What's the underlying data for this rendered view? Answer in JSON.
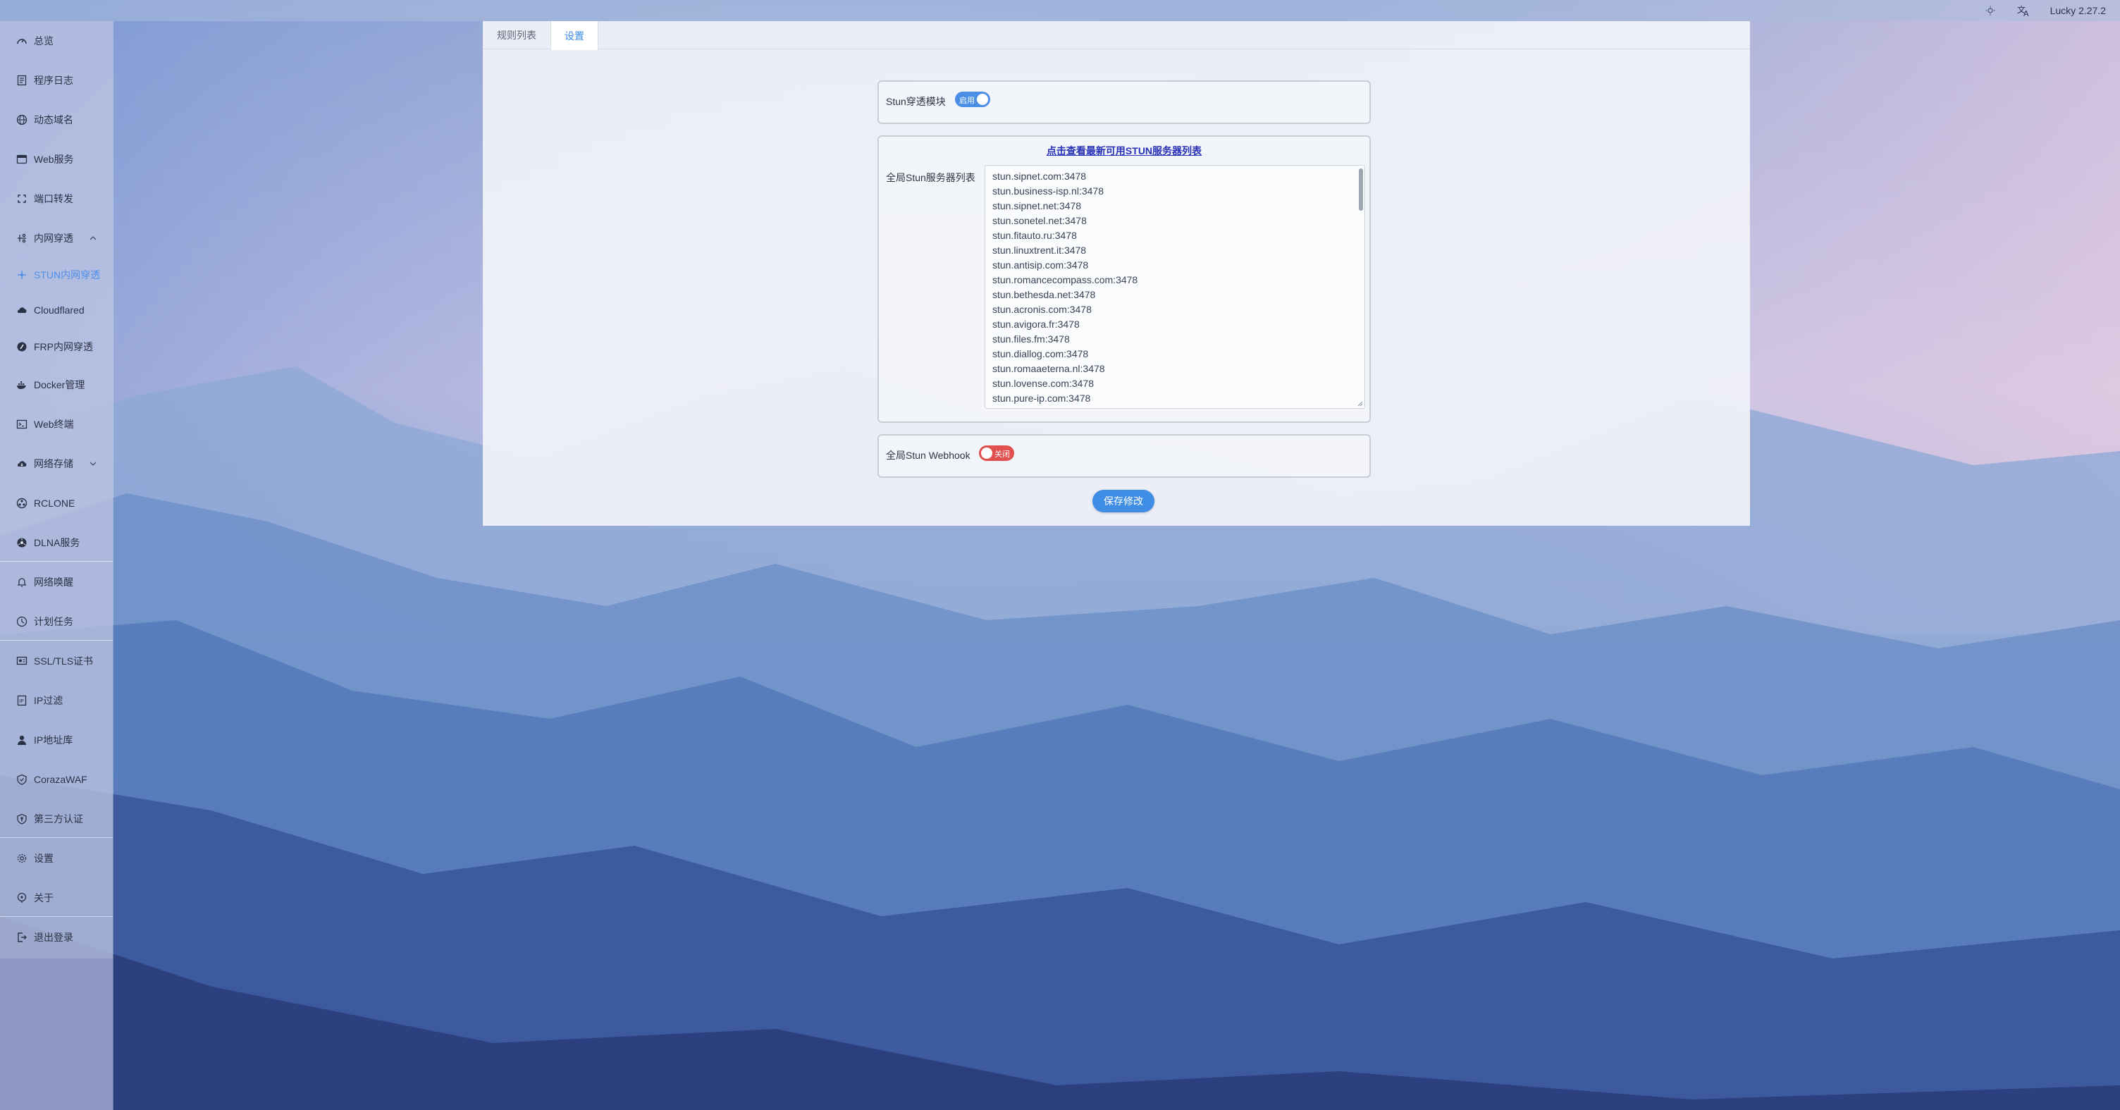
{
  "topbar": {
    "version_label": "Lucky 2.27.2",
    "theme_icon": "sun-icon",
    "language_icon": "translate-icon"
  },
  "sidebar": {
    "items": [
      {
        "label": "总览",
        "icon": "dashboard-icon"
      },
      {
        "label": "程序日志",
        "icon": "log-icon"
      },
      {
        "label": "动态域名",
        "icon": "ddns-icon"
      },
      {
        "label": "Web服务",
        "icon": "web-service-icon"
      },
      {
        "label": "端口转发",
        "icon": "port-forward-icon"
      },
      {
        "label": "内网穿透",
        "icon": "tunnel-icon",
        "expanded": true
      },
      {
        "label": "STUN内网穿透",
        "icon": "stun-icon",
        "active": true
      },
      {
        "label": "Cloudflared",
        "icon": "cloud-icon"
      },
      {
        "label": "FRP内网穿透",
        "icon": "frp-icon"
      },
      {
        "label": "Docker管理",
        "icon": "docker-icon"
      },
      {
        "label": "Web终端",
        "icon": "terminal-icon"
      },
      {
        "label": "网络存储",
        "icon": "storage-icon",
        "expanded": false
      },
      {
        "label": "RCLONE",
        "icon": "rclone-icon"
      },
      {
        "label": "DLNA服务",
        "icon": "dlna-icon"
      },
      {
        "label": "网络唤醒",
        "icon": "bell-icon"
      },
      {
        "label": "计划任务",
        "icon": "clock-icon"
      },
      {
        "label": "SSL/TLS证书",
        "icon": "certificate-icon"
      },
      {
        "label": "IP过滤",
        "icon": "filter-icon"
      },
      {
        "label": "IP地址库",
        "icon": "user-icon"
      },
      {
        "label": "CorazaWAF",
        "icon": "shield-icon"
      },
      {
        "label": "第三方认证",
        "icon": "auth-shield-icon"
      },
      {
        "label": "设置",
        "icon": "gear-icon"
      },
      {
        "label": "关于",
        "icon": "info-icon"
      },
      {
        "label": "退出登录",
        "icon": "logout-icon"
      }
    ]
  },
  "tabs": [
    {
      "label": "规则列表",
      "active": false
    },
    {
      "label": "设置",
      "active": true
    }
  ],
  "stun_module": {
    "label": "Stun穿透模块",
    "switch_text": "启用",
    "enabled": true
  },
  "server_list_card": {
    "link_text": "点击查看最新可用STUN服务器列表",
    "label": "全局Stun服务器列表",
    "servers": [
      "stun.sipnet.com:3478",
      "stun.business-isp.nl:3478",
      "stun.sipnet.net:3478",
      "stun.sonetel.net:3478",
      "stun.fitauto.ru:3478",
      "stun.linuxtrent.it:3478",
      "stun.antisip.com:3478",
      "stun.romancecompass.com:3478",
      "stun.bethesda.net:3478",
      "stun.acronis.com:3478",
      "stun.avigora.fr:3478",
      "stun.files.fm:3478",
      "stun.diallog.com:3478",
      "stun.romaaeterna.nl:3478",
      "stun.lovense.com:3478",
      "stun.pure-ip.com:3478"
    ]
  },
  "webhook": {
    "label": "全局Stun Webhook",
    "switch_text": "关闭",
    "enabled": false
  },
  "save_button": {
    "label": "保存修改"
  },
  "colors": {
    "accent": "#3f8de5",
    "switch_on": "#4a8ee6",
    "switch_off": "#e0504e",
    "link": "#2730b8"
  }
}
